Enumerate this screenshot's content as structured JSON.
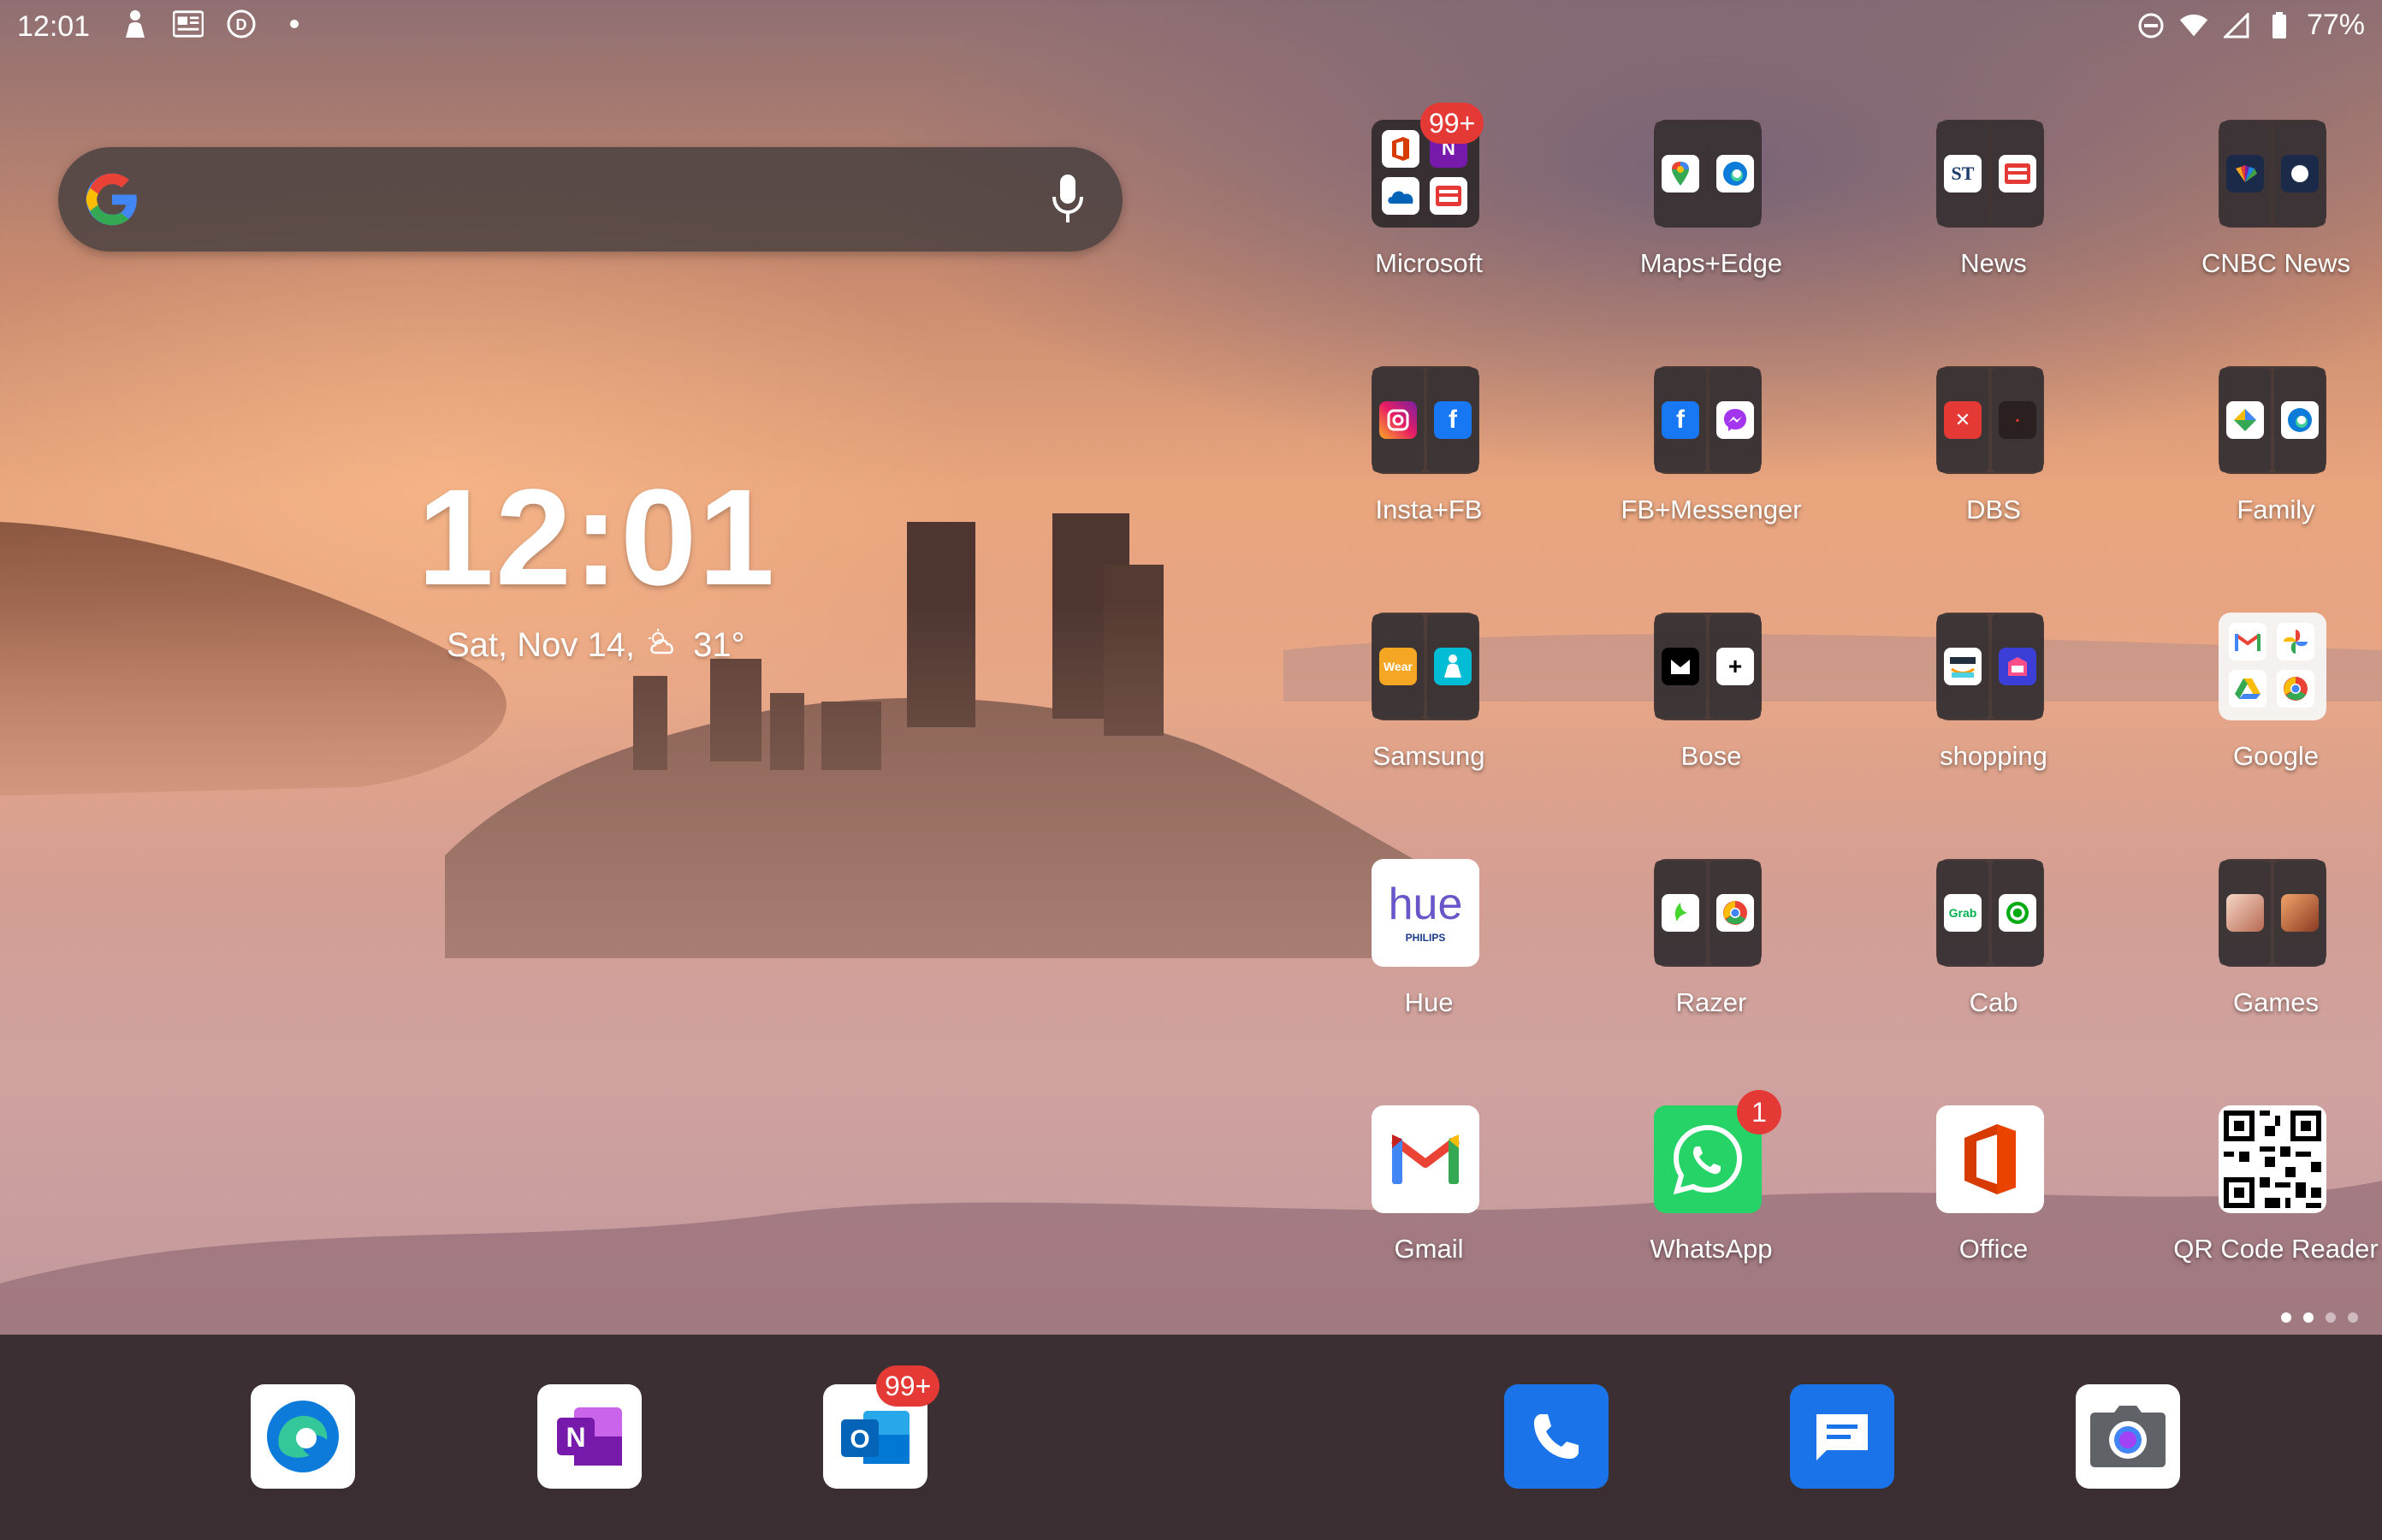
{
  "status_bar": {
    "time": "12:01",
    "battery": "77%",
    "icons": [
      "person-icon",
      "news-icon",
      "d-badge-icon",
      "dot-icon",
      "dnd-icon",
      "wifi-icon",
      "signal-icon",
      "battery-icon"
    ]
  },
  "search": {
    "icons": [
      "google-g-icon",
      "mic-icon"
    ]
  },
  "clock_widget": {
    "time": "12:01",
    "date": "Sat, Nov 14,",
    "temp": "31°",
    "weather_icon": "cloudy-icon"
  },
  "apps": [
    {
      "label": "Microsoft",
      "badge": "99+",
      "type": "folder"
    },
    {
      "label": "Maps+Edge",
      "type": "folder"
    },
    {
      "label": "News",
      "type": "folder"
    },
    {
      "label": "CNBC News",
      "type": "folder"
    },
    {
      "label": "Insta+FB",
      "type": "folder"
    },
    {
      "label": "FB+Messenger",
      "type": "folder"
    },
    {
      "label": "DBS",
      "type": "folder"
    },
    {
      "label": "Family",
      "type": "folder"
    },
    {
      "label": "Samsung",
      "type": "folder"
    },
    {
      "label": "Bose",
      "type": "folder"
    },
    {
      "label": "shopping",
      "type": "folder"
    },
    {
      "label": "Google",
      "type": "folder"
    },
    {
      "label": "Hue",
      "type": "app"
    },
    {
      "label": "Razer",
      "type": "folder"
    },
    {
      "label": "Cab",
      "type": "folder"
    },
    {
      "label": "Games",
      "type": "folder"
    },
    {
      "label": "Gmail",
      "type": "app"
    },
    {
      "label": "WhatsApp",
      "badge": "1",
      "type": "app"
    },
    {
      "label": "Office",
      "type": "app"
    },
    {
      "label": "QR Code Reader",
      "type": "app"
    }
  ],
  "mini_labels": {
    "news_st": "ST",
    "samsung_wear": "Wear",
    "cab_grab": "Grab",
    "hue_text": "hue",
    "hue_brand": "PHILIPS"
  },
  "page_indicator": {
    "count": 4,
    "active": 1
  },
  "dock": [
    {
      "name": "edge",
      "icon": "edge-icon"
    },
    {
      "name": "onenote",
      "icon": "onenote-icon"
    },
    {
      "name": "outlook",
      "icon": "outlook-icon",
      "badge": "99+"
    },
    {
      "name": "phone",
      "icon": "phone-icon"
    },
    {
      "name": "messages",
      "icon": "messages-icon"
    },
    {
      "name": "camera",
      "icon": "camera-icon"
    }
  ],
  "colors": {
    "badge": "#e53935",
    "phone": "#1a73e8",
    "messages": "#1a73e8",
    "whatsapp": "#25d366"
  }
}
